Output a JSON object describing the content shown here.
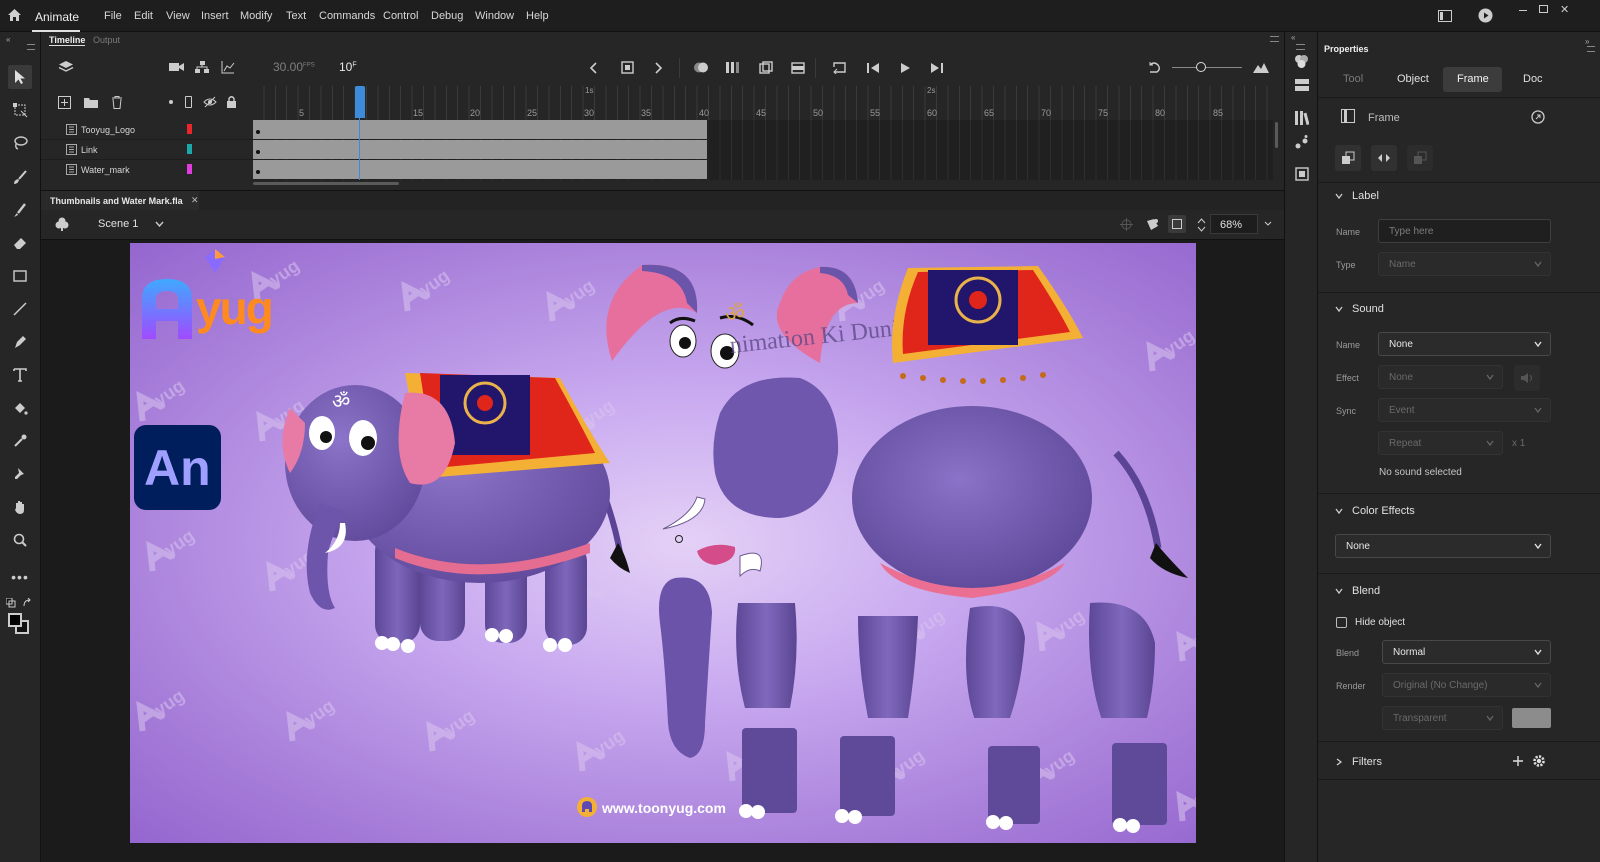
{
  "app": {
    "name": "Animate"
  },
  "menu": [
    "File",
    "Edit",
    "View",
    "Insert",
    "Modify",
    "Text",
    "Commands",
    "Control",
    "Debug",
    "Window",
    "Help"
  ],
  "timeline": {
    "tabs": [
      "Timeline",
      "Output"
    ],
    "fps": "30.00",
    "fps_unit": "FPS",
    "frame": "10",
    "frame_unit": "F",
    "second_markers": [
      "1s",
      "2s"
    ],
    "frame_numbers": [
      "5",
      "15",
      "20",
      "25",
      "30",
      "35",
      "40",
      "45",
      "50",
      "55",
      "60",
      "65",
      "70",
      "75",
      "80",
      "85"
    ],
    "layers": [
      {
        "name": "Tooyug_Logo",
        "color": "#e8262b"
      },
      {
        "name": "Link",
        "color": "#1aa8a8"
      },
      {
        "name": "Water_mark",
        "color": "#e23be0"
      }
    ]
  },
  "document": {
    "tab_title": "Thumbnails and Water Mark.fla",
    "scene": "Scene 1",
    "zoom": "68%"
  },
  "stage": {
    "logo_text": "yug",
    "an_badge": "An",
    "watermark_text": "nimation Ki Duni",
    "website": "www.toonyug.com",
    "om_symbol": "ॐ",
    "bg_colors": [
      "#e4d1f6",
      "#a77ed9"
    ]
  },
  "properties": {
    "title": "Properties",
    "tabs": [
      "Tool",
      "Object",
      "Frame",
      "Doc"
    ],
    "active_tab": "Frame",
    "frame_heading": "Frame",
    "label": {
      "title": "Label",
      "name_label": "Name",
      "name_placeholder": "Type here",
      "type_label": "Type",
      "type_value": "Name"
    },
    "sound": {
      "title": "Sound",
      "name_label": "Name",
      "name_value": "None",
      "effect_label": "Effect",
      "effect_value": "None",
      "sync_label": "Sync",
      "sync_value": "Event",
      "repeat_value": "Repeat",
      "repeat_count": "x 1",
      "status": "No sound selected"
    },
    "color_effects": {
      "title": "Color Effects",
      "value": "None"
    },
    "blend": {
      "title": "Blend",
      "hide_object": "Hide object",
      "blend_label": "Blend",
      "blend_value": "Normal",
      "render_label": "Render",
      "render_value": "Original (No Change)",
      "transparent_value": "Transparent"
    },
    "filters": {
      "title": "Filters"
    }
  }
}
